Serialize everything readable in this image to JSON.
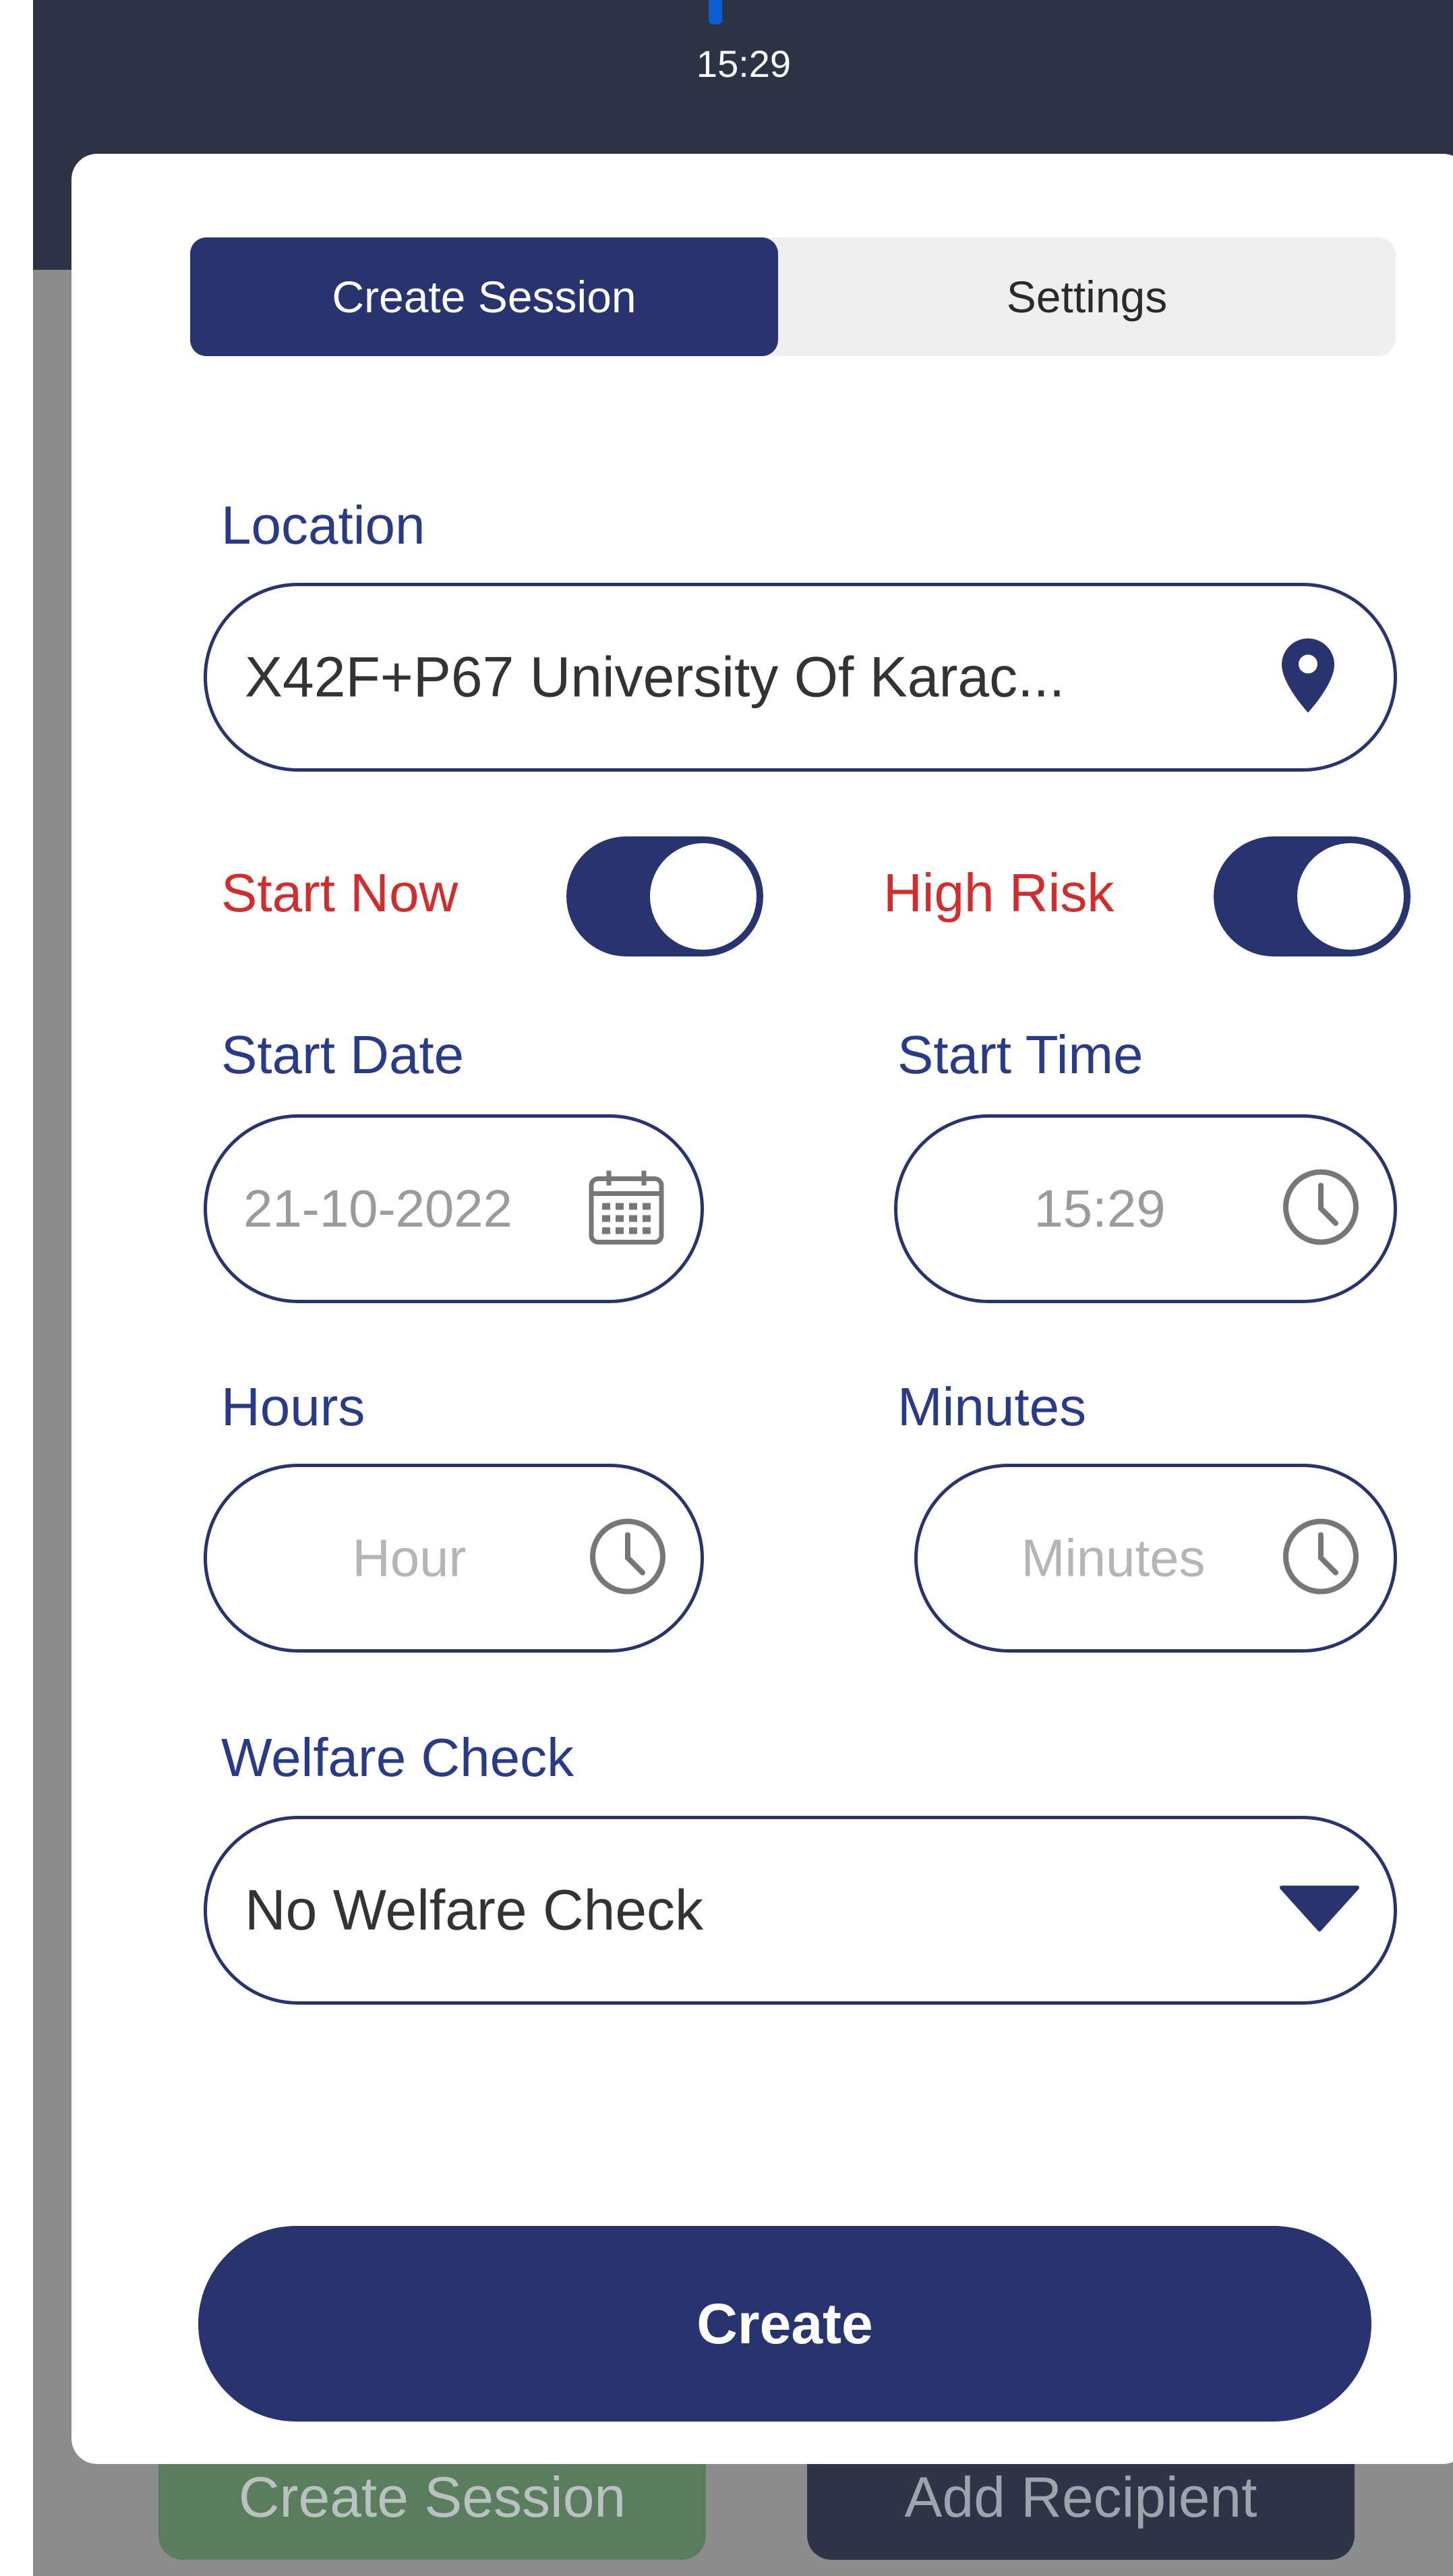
{
  "status_bar": {
    "time": "15:29"
  },
  "tabs": [
    {
      "label": "Create Session",
      "active": true
    },
    {
      "label": "Settings",
      "active": false
    }
  ],
  "location": {
    "label": "Location",
    "value": "X42F+P67 University Of Karac...",
    "icon": "location-pin-icon"
  },
  "toggles": {
    "start_now": {
      "label": "Start Now",
      "on": true
    },
    "high_risk": {
      "label": "High Risk",
      "on": true
    }
  },
  "start_date": {
    "label": "Start Date",
    "value": "21-10-2022",
    "icon": "calendar-icon"
  },
  "start_time": {
    "label": "Start Time",
    "value": "15:29",
    "icon": "clock-icon"
  },
  "hours": {
    "label": "Hours",
    "placeholder": "Hour",
    "icon": "clock-icon"
  },
  "minutes": {
    "label": "Minutes",
    "placeholder": "Minutes",
    "icon": "clock-icon"
  },
  "welfare_check": {
    "label": "Welfare Check",
    "selected": "No Welfare Check",
    "icon": "dropdown-arrow-icon"
  },
  "create_button": {
    "label": "Create"
  },
  "background_buttons": {
    "create_session": "Create Session",
    "add_recipient": "Add Recipient"
  },
  "colors": {
    "primary": "#283470",
    "label_blue": "#283a8a",
    "label_red": "#d62b2b"
  }
}
